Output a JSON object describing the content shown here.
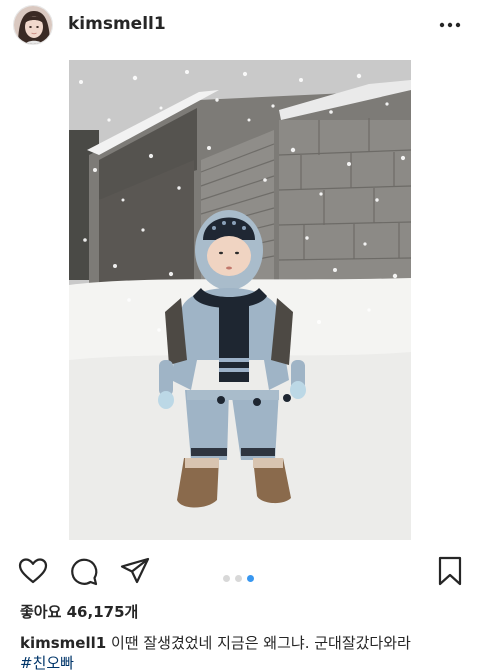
{
  "post": {
    "username": "kimsmell1",
    "likes_label": "좋아요 46,175개",
    "caption_text": "이땐 잘생겼었네  지금은 왜그냐.  군대잘갔다와라",
    "hashtag": "#친오빠"
  },
  "carousel": {
    "count": 3,
    "active_index": 2
  },
  "icons": {
    "more": "more-options-icon",
    "like": "heart-icon",
    "comment": "comment-icon",
    "share": "send-icon",
    "save": "bookmark-icon"
  },
  "colors": {
    "accent": "#3897f0",
    "text": "#262626",
    "hashtag": "#003569"
  }
}
